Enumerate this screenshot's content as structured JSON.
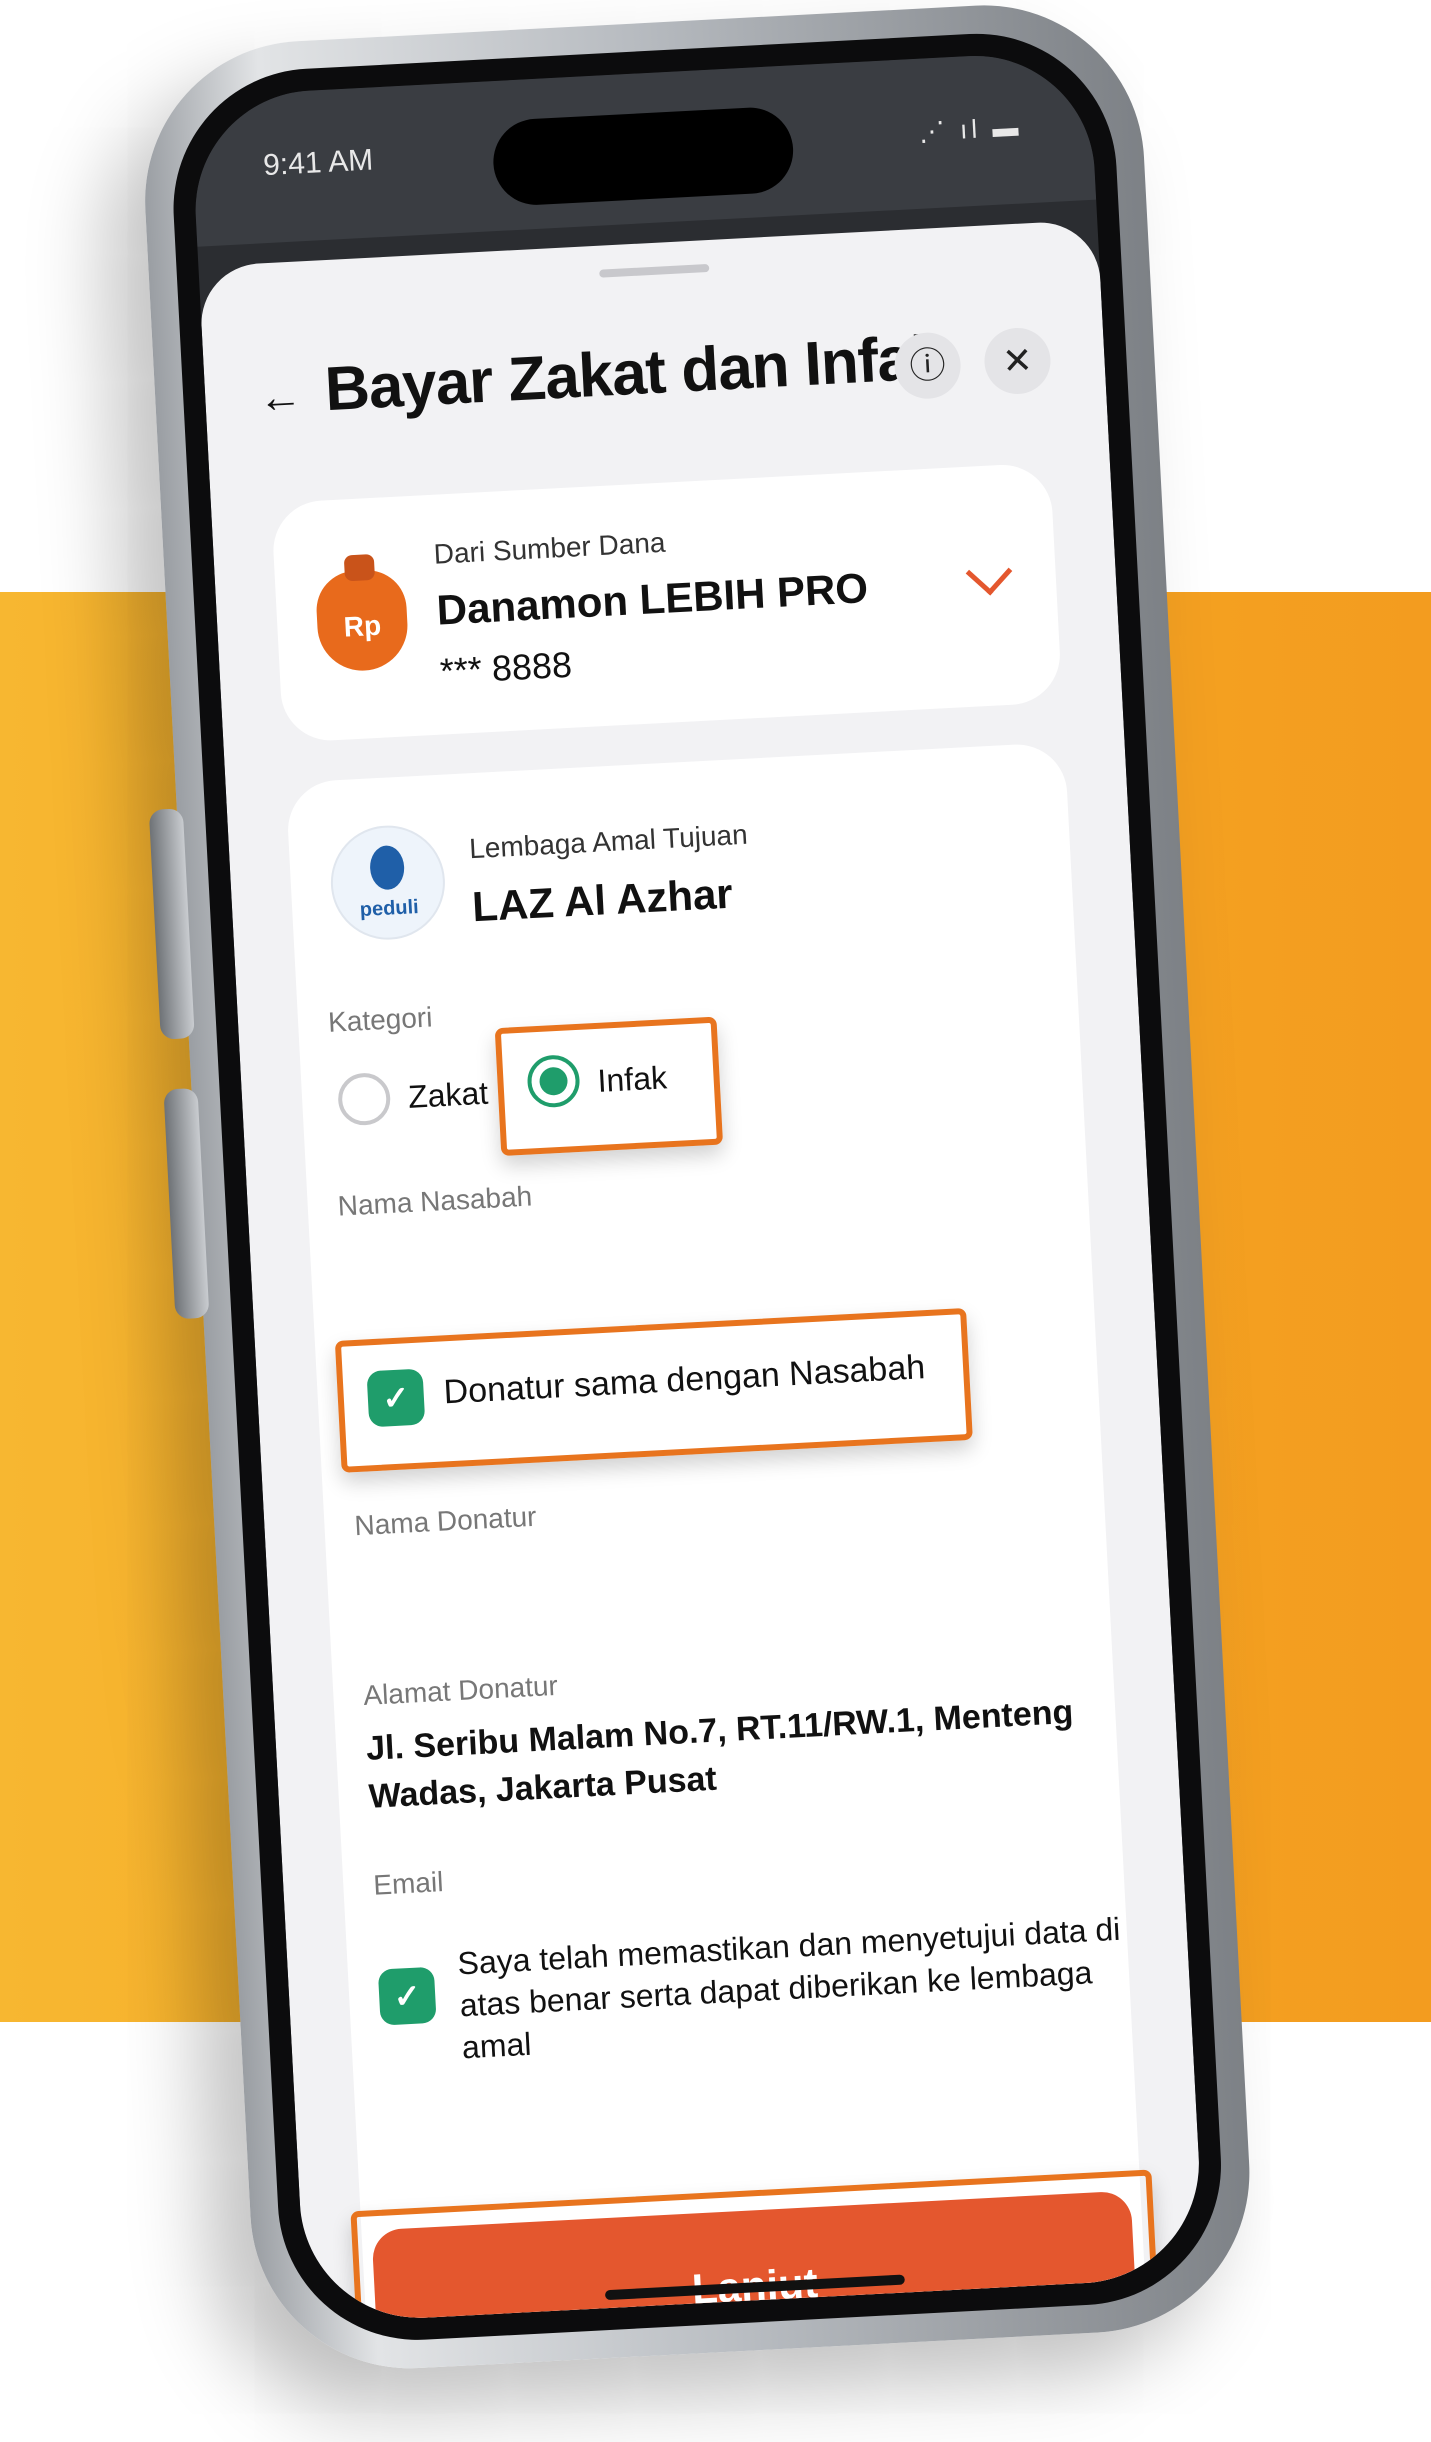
{
  "status_bar": {
    "time": "9:41 AM",
    "signal": "⋰ ıl ▬"
  },
  "header": {
    "title": "Bayar Zakat dan Infak",
    "back_icon": "←",
    "info_icon": "ⓘ",
    "close_icon": "✕"
  },
  "source": {
    "label": "Dari Sumber Dana",
    "account_name": "Danamon LEBIH PRO",
    "account_number": "*** 8888",
    "icon_text": "Rp"
  },
  "charity": {
    "label": "Lembaga Amal Tujuan",
    "name": "LAZ Al Azhar",
    "logo_text": "peduli"
  },
  "category": {
    "label": "Kategori",
    "options": [
      {
        "label": "Zakat",
        "selected": false
      },
      {
        "label": "Infak",
        "selected": true
      }
    ]
  },
  "customer_name": {
    "label": "Nama Nasabah"
  },
  "donor_same": {
    "label": "Donatur sama dengan Nasabah",
    "checked": true
  },
  "donor_name": {
    "label": "Nama Donatur"
  },
  "donor_address": {
    "label": "Alamat Donatur",
    "line1": "Jl. Seribu Malam No.7, RT.11/RW.1, Menteng",
    "line2": "Wadas, Jakarta Pusat"
  },
  "email": {
    "label": "Email"
  },
  "agreement": {
    "line1": "Saya telah memastikan dan menyetujui data di",
    "line2": "atas benar serta dapat diberikan ke lembaga",
    "line3": "amal",
    "checked": true
  },
  "cta": {
    "label": "Lanjut"
  },
  "colors": {
    "accent": "#e4572e",
    "green": "#1f9d6b",
    "highlight": "#e8741e",
    "band": "#f5a623"
  }
}
